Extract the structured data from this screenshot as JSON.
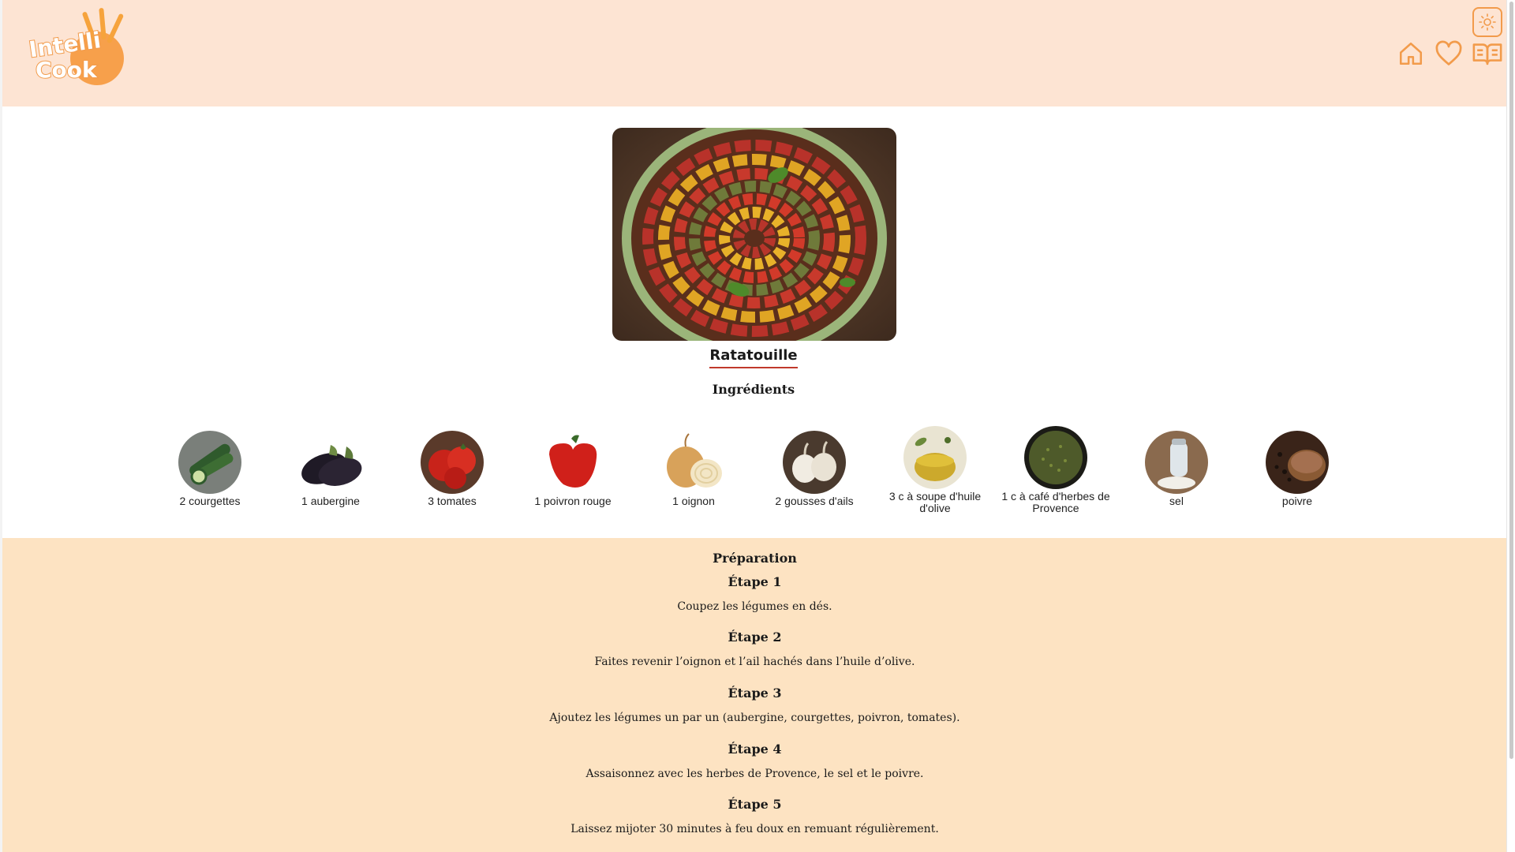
{
  "header": {
    "logo_text": [
      "Intelli",
      "Cook"
    ],
    "colors": {
      "accent": "#f29b4b",
      "header_bg": "#fde4d3",
      "prep_bg": "#fde3c2"
    },
    "icons": [
      "theme-toggle-icon",
      "home-icon",
      "heart-icon",
      "book-icon"
    ]
  },
  "recipe": {
    "title": "Ratatouille",
    "ingredients_heading": "Ingrédients",
    "ingredients": [
      {
        "label": "2 courgettes",
        "icon": "zucchini-icon"
      },
      {
        "label": "1 aubergine",
        "icon": "eggplant-icon"
      },
      {
        "label": "3 tomates",
        "icon": "tomato-icon"
      },
      {
        "label": "1 poivron rouge",
        "icon": "bell-pepper-icon"
      },
      {
        "label": "1 oignon",
        "icon": "onion-icon"
      },
      {
        "label": "2 gousses d'ails",
        "icon": "garlic-icon"
      },
      {
        "label": "3 c à soupe d'huile d'olive",
        "icon": "olive-oil-icon"
      },
      {
        "label": "1 c à café d'herbes de Provence",
        "icon": "herbs-icon"
      },
      {
        "label": "sel",
        "icon": "salt-icon"
      },
      {
        "label": "poivre",
        "icon": "pepper-icon"
      }
    ]
  },
  "preparation": {
    "heading": "Préparation",
    "steps": [
      {
        "title": "Étape 1",
        "text": "Coupez les légumes en dés."
      },
      {
        "title": "Étape 2",
        "text": "Faites revenir l’oignon et l’ail hachés dans l’huile d’olive."
      },
      {
        "title": "Étape 3",
        "text": "Ajoutez les légumes un par un (aubergine, courgettes, poivron, tomates)."
      },
      {
        "title": "Étape 4",
        "text": "Assaisonnez avec les herbes de Provence, le sel et le poivre."
      },
      {
        "title": "Étape 5",
        "text": "Laissez mijoter 30 minutes à feu doux en remuant régulièrement."
      }
    ]
  }
}
